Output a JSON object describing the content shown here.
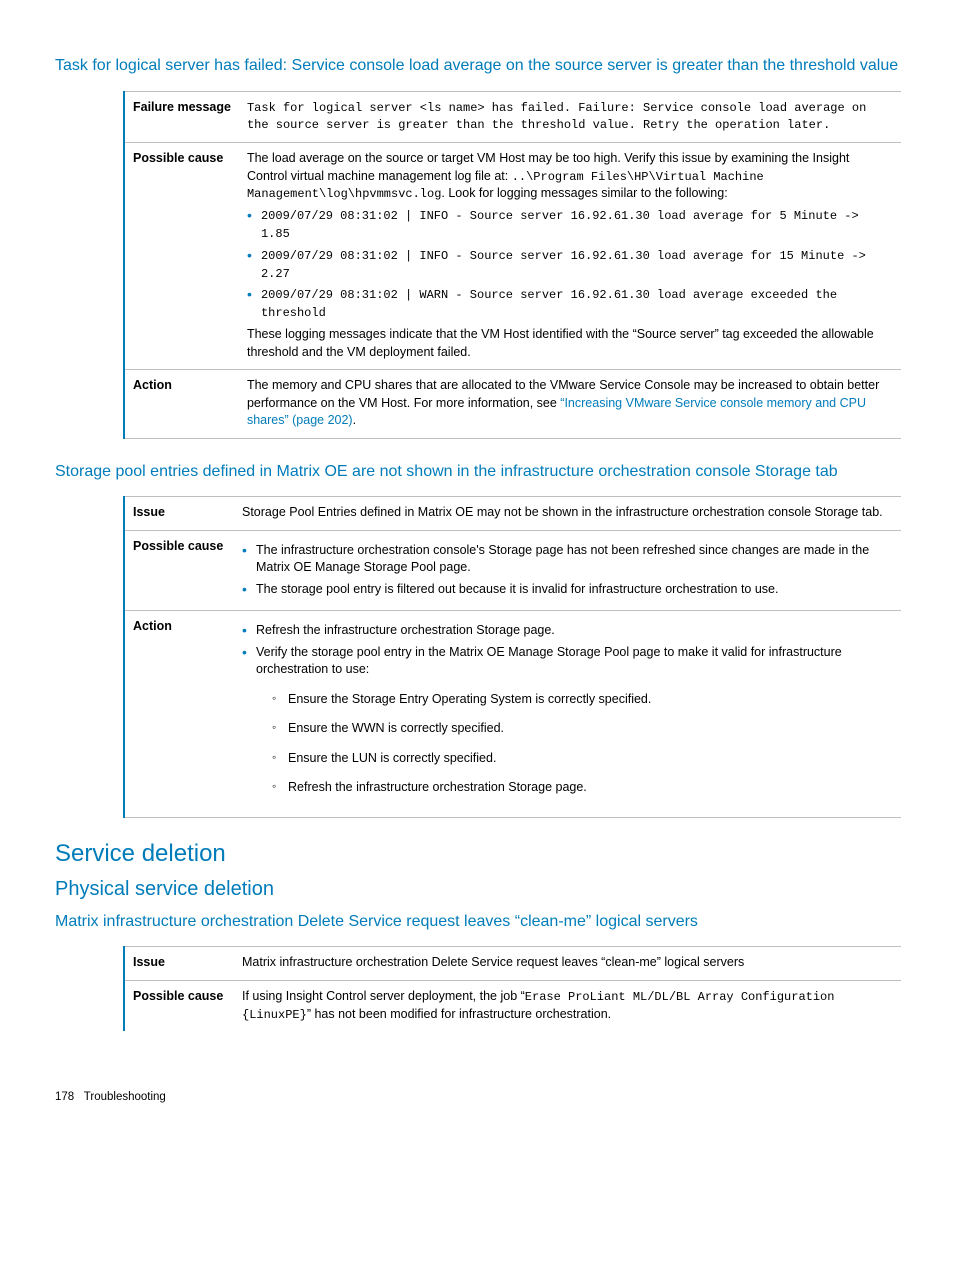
{
  "sec1": {
    "title": "Task for logical server has failed: Service console load average on the source server is greater than the threshold value",
    "row1": {
      "label": "Failure message",
      "text": "Task for logical server <ls name> has failed. Failure: Service console load average on the source server is greater than the threshold value. Retry the operation later."
    },
    "row2": {
      "label": "Possible cause",
      "intro_a": "The load average on the source or target VM Host may be too high. Verify this issue by examining the Insight Control virtual machine management log file at: ",
      "intro_path": "..\\Program Files\\HP\\Virtual Machine Management\\log\\hpvmmsvc.log",
      "intro_b": ". Look for logging messages similar to the following:",
      "b1": "2009/07/29 08:31:02 | INFO - Source server 16.92.61.30 load average for 5 Minute -> 1.85",
      "b2": "2009/07/29 08:31:02 | INFO - Source server 16.92.61.30 load average for 15 Minute -> 2.27",
      "b3": "2009/07/29 08:31:02 | WARN - Source server 16.92.61.30 load average exceeded the threshold",
      "outro": "These logging messages indicate that the VM Host identified with the “Source server” tag exceeded the allowable threshold and the VM deployment failed."
    },
    "row3": {
      "label": "Action",
      "text_a": "The memory and CPU shares that are allocated to the VMware Service Console may be increased to obtain better performance on the VM Host. For more information, see ",
      "link": "“Increasing VMware Service console memory and CPU shares” (page 202)",
      "text_b": "."
    }
  },
  "sec2": {
    "title": "Storage pool entries defined in Matrix OE are not shown in the infrastructure orchestration console Storage tab",
    "row1": {
      "label": "Issue",
      "text": "Storage Pool Entries defined in Matrix OE may not be shown in the infrastructure orchestration console Storage tab."
    },
    "row2": {
      "label": "Possible cause",
      "b1": "The infrastructure orchestration console's Storage page has not been refreshed since changes are made in the Matrix OE Manage Storage Pool page.",
      "b2": "The storage pool entry is filtered out because it is invalid for infrastructure orchestration to use."
    },
    "row3": {
      "label": "Action",
      "b1": "Refresh the infrastructure orchestration Storage page.",
      "b2": "Verify the storage pool entry in the Matrix OE Manage Storage Pool page to make it valid for infrastructure orchestration to use:",
      "s1": "Ensure the Storage Entry Operating System is correctly specified.",
      "s2": "Ensure the WWN is correctly specified.",
      "s3": "Ensure the LUN is correctly specified.",
      "s4": "Refresh the infrastructure orchestration Storage page."
    }
  },
  "sec3": {
    "h1": "Service deletion",
    "h2": "Physical service deletion",
    "h3": "Matrix infrastructure orchestration Delete Service request leaves “clean-me” logical servers",
    "row1": {
      "label": "Issue",
      "text": "Matrix infrastructure orchestration Delete Service request leaves “clean-me” logical servers"
    },
    "row2": {
      "label": "Possible cause",
      "a": "If using Insight Control server deployment, the job “",
      "mono": "Erase ProLiant ML/DL/BL Array Configuration {LinuxPE}",
      "b": "” has not been modified for infrastructure orchestration."
    }
  },
  "footer": {
    "page": "178",
    "section": "Troubleshooting"
  }
}
